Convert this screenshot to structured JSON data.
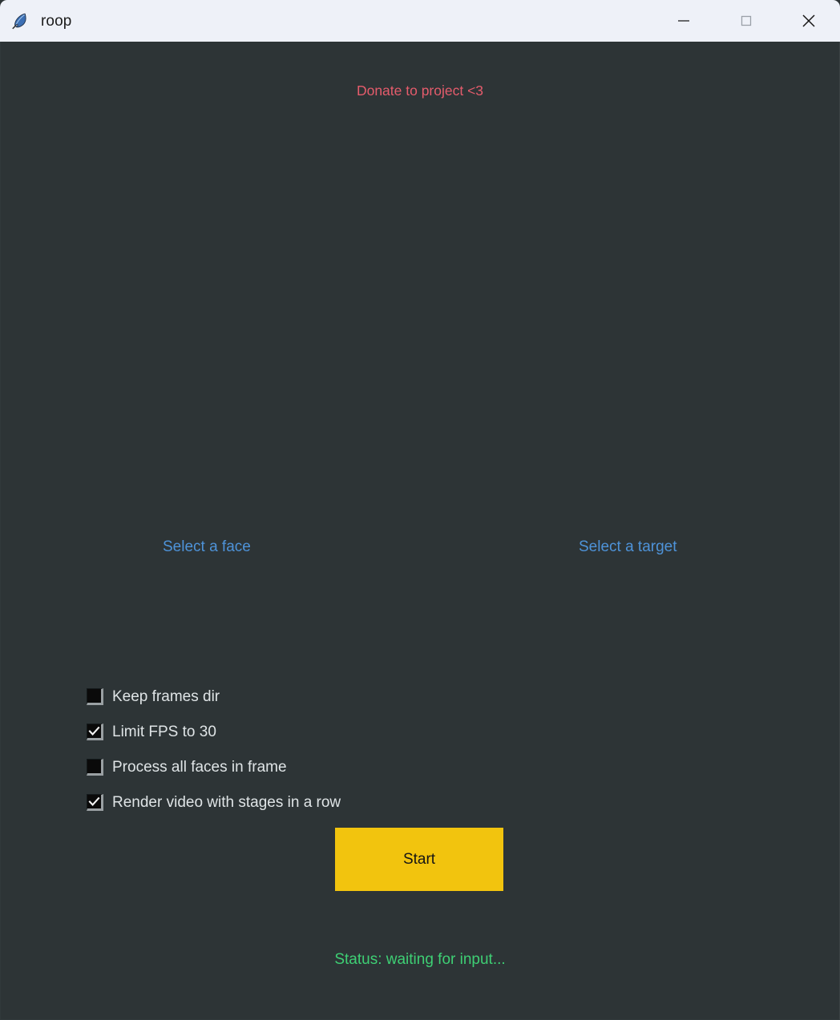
{
  "window": {
    "title": "roop",
    "icon": "feather-quill-icon",
    "background_color": "#2d3436",
    "titlebar_color": "#eef1f8",
    "controls": {
      "minimize_label": "Minimize",
      "maximize_label": "Maximize",
      "close_label": "Close"
    }
  },
  "donate": {
    "label": "Donate to project <3",
    "color": "#e55c6c"
  },
  "previews": {
    "face": {
      "select_label": "Select a face"
    },
    "target": {
      "select_label": "Select a target"
    },
    "link_color": "#4e93d9"
  },
  "options": [
    {
      "label": "Keep frames dir",
      "checked": false
    },
    {
      "label": "Limit FPS to 30",
      "checked": true
    },
    {
      "label": "Process all faces in frame",
      "checked": false
    },
    {
      "label": "Render video with stages in a row",
      "checked": true
    }
  ],
  "start_button": {
    "label": "Start",
    "background_color": "#f2c40e",
    "text_color": "#151515"
  },
  "status": {
    "text": "Status: waiting for input...",
    "color": "#3ecf74"
  }
}
